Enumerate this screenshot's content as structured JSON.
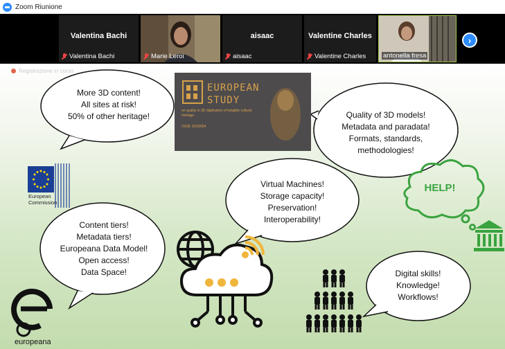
{
  "window": {
    "title": "Zoom Riunione"
  },
  "participants": [
    {
      "display_name": "Valentina Bachi",
      "label": "Valentina Bachi",
      "video": false,
      "muted": true
    },
    {
      "display_name": "",
      "label": "Marie Leroi",
      "video": true,
      "muted": true
    },
    {
      "display_name": "aisaac",
      "label": "aisaac",
      "video": false,
      "muted": true
    },
    {
      "display_name": "Valentine Charles",
      "label": "Valentine Charles",
      "video": false,
      "muted": true
    },
    {
      "display_name": "",
      "label": "antonella fresa",
      "video": true,
      "muted": false,
      "active_speaker": true
    }
  ],
  "next_page_icon": "chevron-right-icon",
  "recording": {
    "label": "Registrazione in corso"
  },
  "slide": {
    "bubbles": {
      "top_left": [
        "More 3D content!",
        "All sites at risk!",
        "50% of other heritage!"
      ],
      "top_right": [
        "Quality of 3D models!",
        "Metadata and paradata!",
        "Formats, standards,",
        "methodologies!"
      ],
      "middle": [
        "Virtual Machines!",
        "Storage capacity!",
        "Preservation!",
        "Interoperability!"
      ],
      "bottom_left": [
        "Content tiers!",
        "Metadata tiers!",
        "Europeana Data Model!",
        "Open access!",
        "Data Space!"
      ],
      "bottom_right": [
        "Digital skills!",
        "Knowledge!",
        "Workflows!"
      ],
      "help": "HELP!"
    },
    "eu_study": {
      "title_line1": "EUROPEAN",
      "title_line2": "STUDY",
      "subtitle": "on quality in 3D digitisation of tangible cultural heritage",
      "reference": "VIGIE 2020/654"
    },
    "ec_logo": {
      "line1": "European",
      "line2": "Commission"
    },
    "europeana_logo": {
      "text": "europeana"
    }
  },
  "colors": {
    "zoom_blue": "#2d8cff",
    "gold": "#d7a24a",
    "help_green": "#3aa33f",
    "orange_accent": "#f0b63c"
  }
}
